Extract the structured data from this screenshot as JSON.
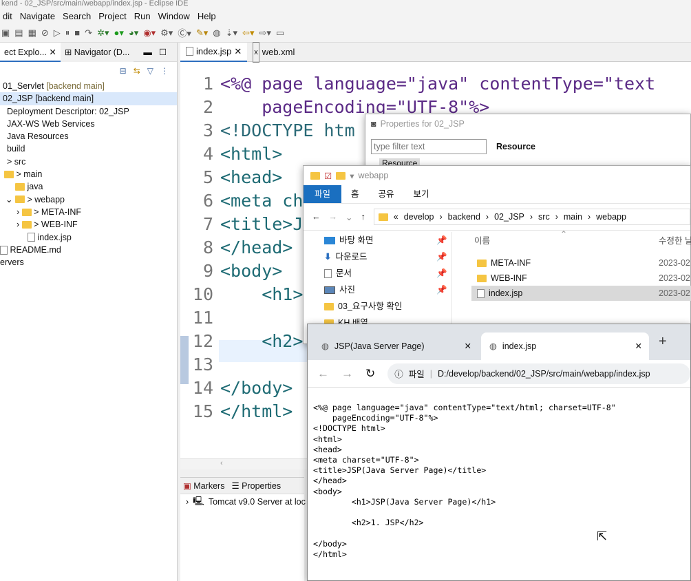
{
  "eclipse": {
    "title": "kend - 02_JSP/src/main/webapp/index.jsp - Eclipse IDE",
    "menu": [
      "dit",
      "Navigate",
      "Search",
      "Project",
      "Run",
      "Window",
      "Help"
    ],
    "left_tabs": [
      "ect Explo...",
      "Navigator (D..."
    ],
    "tree": [
      {
        "label": "01_Servlet",
        "tag": "[backend main]"
      },
      {
        "label": "02_JSP",
        "tag": "[backend main]"
      },
      {
        "label": "Deployment Descriptor: 02_JSP",
        "tag": ""
      },
      {
        "label": "JAX-WS Web Services",
        "tag": ""
      },
      {
        "label": "Java Resources",
        "tag": ""
      },
      {
        "label": "build",
        "tag": ""
      },
      {
        "label": "> src",
        "tag": ""
      },
      {
        "label": "> main",
        "tag": ""
      },
      {
        "label": "java",
        "tag": ""
      },
      {
        "label": "> webapp",
        "tag": ""
      },
      {
        "label": "> META-INF",
        "tag": ""
      },
      {
        "label": "> WEB-INF",
        "tag": ""
      },
      {
        "label": "index.jsp",
        "tag": ""
      },
      {
        "label": "README.md",
        "tag": ""
      },
      {
        "label": "ervers",
        "tag": ""
      }
    ],
    "editor_tabs": [
      "index.jsp",
      "web.xml"
    ],
    "code_lines": [
      {
        "n": "1",
        "t": "<%@ page language=\"java\" contentType=\"text"
      },
      {
        "n": "2",
        "t": "    pageEncoding=\"UTF-8\"%>"
      },
      {
        "n": "3",
        "t": "<!DOCTYPE htm"
      },
      {
        "n": "4",
        "t": "<html>"
      },
      {
        "n": "5",
        "t": "<head>"
      },
      {
        "n": "6",
        "t": "<meta ch"
      },
      {
        "n": "7",
        "t": "<title>J"
      },
      {
        "n": "8",
        "t": "</head>"
      },
      {
        "n": "9",
        "t": "<body>"
      },
      {
        "n": "10",
        "t": "    <h1>"
      },
      {
        "n": "11",
        "t": ""
      },
      {
        "n": "12",
        "t": "    <h2>"
      },
      {
        "n": "13",
        "t": ""
      },
      {
        "n": "14",
        "t": "</body>"
      },
      {
        "n": "15",
        "t": "</html>"
      }
    ],
    "bottom_tabs": [
      "Markers",
      "Properties"
    ],
    "server_row": "Tomcat v9.0 Server at loc"
  },
  "properties_dialog": {
    "title": "Properties for 02_JSP",
    "filter_placeholder": "type filter text",
    "header": "Resource",
    "item": "Resource"
  },
  "file_explorer": {
    "title": "webapp",
    "ribbon": [
      "파일",
      "홈",
      "공유",
      "보기"
    ],
    "path": [
      "develop",
      "backend",
      "02_JSP",
      "src",
      "main",
      "webapp"
    ],
    "sidebar": [
      "바탕 화면",
      "다운로드",
      "문서",
      "사진",
      "03_요구사항 확인",
      "KH 배열"
    ],
    "col_name": "이름",
    "col_date": "수정한 날",
    "files": [
      {
        "name": "META-INF",
        "date": "2023-02"
      },
      {
        "name": "WEB-INF",
        "date": "2023-02"
      },
      {
        "name": "index.jsp",
        "date": "2023-02"
      }
    ]
  },
  "browser": {
    "tabs": [
      "JSP(Java Server Page)",
      "index.jsp"
    ],
    "address_label": "파일",
    "address": "D:/develop/backend/02_JSP/src/main/webapp/index.jsp",
    "source": "<%@ page language=\"java\" contentType=\"text/html; charset=UTF-8\"\n    pageEncoding=\"UTF-8\"%>\n<!DOCTYPE html>\n<html>\n<head>\n<meta charset=\"UTF-8\">\n<title>JSP(Java Server Page)</title>\n</head>\n<body>\n        <h1>JSP(Java Server Page)</h1>\n\n        <h2>1. JSP</h2>\n\n</body>\n</html>"
  }
}
